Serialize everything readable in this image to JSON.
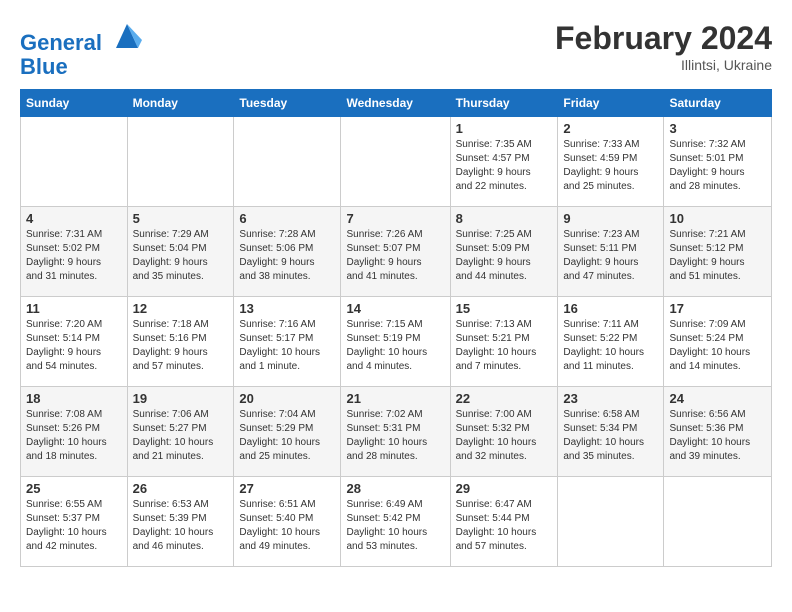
{
  "header": {
    "logo_line1": "General",
    "logo_line2": "Blue",
    "month_year": "February 2024",
    "location": "Illintsi, Ukraine"
  },
  "weekdays": [
    "Sunday",
    "Monday",
    "Tuesday",
    "Wednesday",
    "Thursday",
    "Friday",
    "Saturday"
  ],
  "weeks": [
    [
      {
        "day": "",
        "info": ""
      },
      {
        "day": "",
        "info": ""
      },
      {
        "day": "",
        "info": ""
      },
      {
        "day": "",
        "info": ""
      },
      {
        "day": "1",
        "info": "Sunrise: 7:35 AM\nSunset: 4:57 PM\nDaylight: 9 hours\nand 22 minutes."
      },
      {
        "day": "2",
        "info": "Sunrise: 7:33 AM\nSunset: 4:59 PM\nDaylight: 9 hours\nand 25 minutes."
      },
      {
        "day": "3",
        "info": "Sunrise: 7:32 AM\nSunset: 5:01 PM\nDaylight: 9 hours\nand 28 minutes."
      }
    ],
    [
      {
        "day": "4",
        "info": "Sunrise: 7:31 AM\nSunset: 5:02 PM\nDaylight: 9 hours\nand 31 minutes."
      },
      {
        "day": "5",
        "info": "Sunrise: 7:29 AM\nSunset: 5:04 PM\nDaylight: 9 hours\nand 35 minutes."
      },
      {
        "day": "6",
        "info": "Sunrise: 7:28 AM\nSunset: 5:06 PM\nDaylight: 9 hours\nand 38 minutes."
      },
      {
        "day": "7",
        "info": "Sunrise: 7:26 AM\nSunset: 5:07 PM\nDaylight: 9 hours\nand 41 minutes."
      },
      {
        "day": "8",
        "info": "Sunrise: 7:25 AM\nSunset: 5:09 PM\nDaylight: 9 hours\nand 44 minutes."
      },
      {
        "day": "9",
        "info": "Sunrise: 7:23 AM\nSunset: 5:11 PM\nDaylight: 9 hours\nand 47 minutes."
      },
      {
        "day": "10",
        "info": "Sunrise: 7:21 AM\nSunset: 5:12 PM\nDaylight: 9 hours\nand 51 minutes."
      }
    ],
    [
      {
        "day": "11",
        "info": "Sunrise: 7:20 AM\nSunset: 5:14 PM\nDaylight: 9 hours\nand 54 minutes."
      },
      {
        "day": "12",
        "info": "Sunrise: 7:18 AM\nSunset: 5:16 PM\nDaylight: 9 hours\nand 57 minutes."
      },
      {
        "day": "13",
        "info": "Sunrise: 7:16 AM\nSunset: 5:17 PM\nDaylight: 10 hours\nand 1 minute."
      },
      {
        "day": "14",
        "info": "Sunrise: 7:15 AM\nSunset: 5:19 PM\nDaylight: 10 hours\nand 4 minutes."
      },
      {
        "day": "15",
        "info": "Sunrise: 7:13 AM\nSunset: 5:21 PM\nDaylight: 10 hours\nand 7 minutes."
      },
      {
        "day": "16",
        "info": "Sunrise: 7:11 AM\nSunset: 5:22 PM\nDaylight: 10 hours\nand 11 minutes."
      },
      {
        "day": "17",
        "info": "Sunrise: 7:09 AM\nSunset: 5:24 PM\nDaylight: 10 hours\nand 14 minutes."
      }
    ],
    [
      {
        "day": "18",
        "info": "Sunrise: 7:08 AM\nSunset: 5:26 PM\nDaylight: 10 hours\nand 18 minutes."
      },
      {
        "day": "19",
        "info": "Sunrise: 7:06 AM\nSunset: 5:27 PM\nDaylight: 10 hours\nand 21 minutes."
      },
      {
        "day": "20",
        "info": "Sunrise: 7:04 AM\nSunset: 5:29 PM\nDaylight: 10 hours\nand 25 minutes."
      },
      {
        "day": "21",
        "info": "Sunrise: 7:02 AM\nSunset: 5:31 PM\nDaylight: 10 hours\nand 28 minutes."
      },
      {
        "day": "22",
        "info": "Sunrise: 7:00 AM\nSunset: 5:32 PM\nDaylight: 10 hours\nand 32 minutes."
      },
      {
        "day": "23",
        "info": "Sunrise: 6:58 AM\nSunset: 5:34 PM\nDaylight: 10 hours\nand 35 minutes."
      },
      {
        "day": "24",
        "info": "Sunrise: 6:56 AM\nSunset: 5:36 PM\nDaylight: 10 hours\nand 39 minutes."
      }
    ],
    [
      {
        "day": "25",
        "info": "Sunrise: 6:55 AM\nSunset: 5:37 PM\nDaylight: 10 hours\nand 42 minutes."
      },
      {
        "day": "26",
        "info": "Sunrise: 6:53 AM\nSunset: 5:39 PM\nDaylight: 10 hours\nand 46 minutes."
      },
      {
        "day": "27",
        "info": "Sunrise: 6:51 AM\nSunset: 5:40 PM\nDaylight: 10 hours\nand 49 minutes."
      },
      {
        "day": "28",
        "info": "Sunrise: 6:49 AM\nSunset: 5:42 PM\nDaylight: 10 hours\nand 53 minutes."
      },
      {
        "day": "29",
        "info": "Sunrise: 6:47 AM\nSunset: 5:44 PM\nDaylight: 10 hours\nand 57 minutes."
      },
      {
        "day": "",
        "info": ""
      },
      {
        "day": "",
        "info": ""
      }
    ]
  ]
}
